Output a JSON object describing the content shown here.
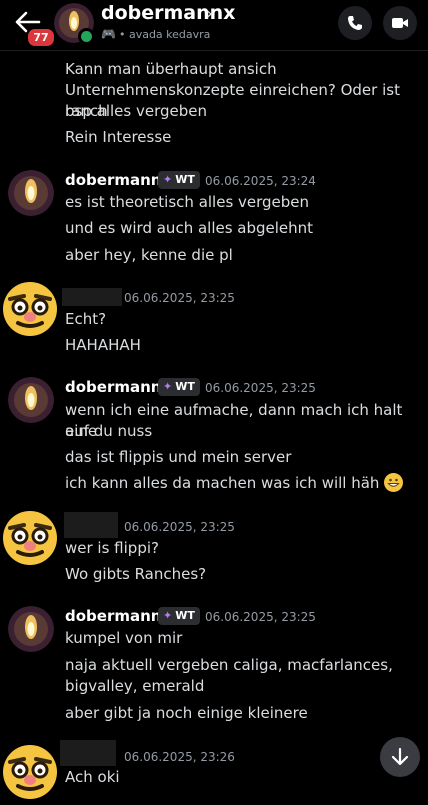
{
  "header": {
    "unread_count": "77",
    "username": "dobermannx",
    "status": "avada kedavra"
  },
  "messages": [
    {
      "lines": [
        "Kann man überhaupt ansich",
        "Unternehmenskonzepte einreichen? Oder ist ranch",
        "bsp alles vergeben",
        "Rein Interesse"
      ]
    },
    {
      "author": "dobermannx",
      "tag": "WT",
      "time": "06.06.2025, 23:24",
      "lines": [
        "es ist theoretisch alles vergeben",
        "und es wird auch alles abgelehnt",
        "aber hey, kenne die pl"
      ]
    },
    {
      "time": "06.06.2025, 23:25",
      "lines": [
        "Echt?",
        "HAHAHAH"
      ]
    },
    {
      "author": "dobermannx",
      "tag": "WT",
      "time": "06.06.2025, 23:25",
      "lines": [
        "wenn ich eine aufmache, dann mach ich halt eine",
        "auf du nuss",
        "das ist flippis und mein server",
        "ich kann alles da machen was ich will häh"
      ]
    },
    {
      "time": "06.06.2025, 23:25",
      "lines": [
        "wer is flippi?",
        "Wo gibts Ranches?"
      ]
    },
    {
      "author": "dobermannx",
      "tag": "WT",
      "time": "06.06.2025, 23:25",
      "lines": [
        "kumpel von mir",
        "naja aktuell vergeben caliga, macfarlances,",
        "bigvalley, emerald",
        "aber gibt ja noch einige kleinere"
      ]
    },
    {
      "time": "06.06.2025, 23:26",
      "lines": [
        "Ach oki"
      ]
    }
  ]
}
